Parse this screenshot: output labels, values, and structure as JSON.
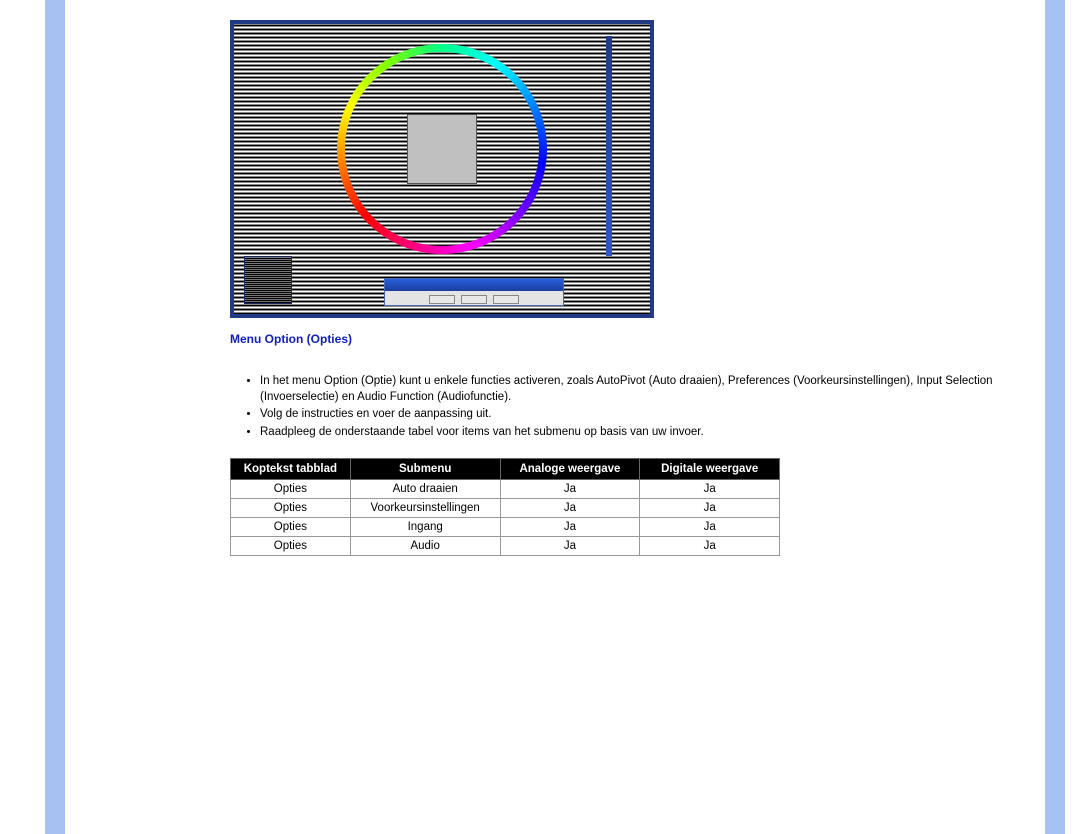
{
  "section_title": "Menu Option (Opties)",
  "bullets": [
    "In het menu Option (Optie) kunt u enkele functies activeren, zoals AutoPivot (Auto draaien), Preferences (Voorkeursinstellingen), Input Selection (Invoerselectie) en Audio Function (Audiofunctie).",
    "Volg de instructies en voer de aanpassing uit.",
    "Raadpleeg de onderstaande tabel voor items van het submenu op basis van uw invoer."
  ],
  "table": {
    "headers": {
      "tab": "Koptekst tabblad",
      "submenu": "Submenu",
      "analog": "Analoge weergave",
      "digital": "Digitale weergave"
    },
    "rows": [
      {
        "tab": "Opties",
        "submenu": "Auto draaien",
        "analog": "Ja",
        "digital": "Ja"
      },
      {
        "tab": "Opties",
        "submenu": "Voorkeursinstellingen",
        "analog": "Ja",
        "digital": "Ja"
      },
      {
        "tab": "Opties",
        "submenu": "Ingang",
        "analog": "Ja",
        "digital": "Ja"
      },
      {
        "tab": "Opties",
        "submenu": "Audio",
        "analog": "Ja",
        "digital": "Ja"
      }
    ]
  }
}
